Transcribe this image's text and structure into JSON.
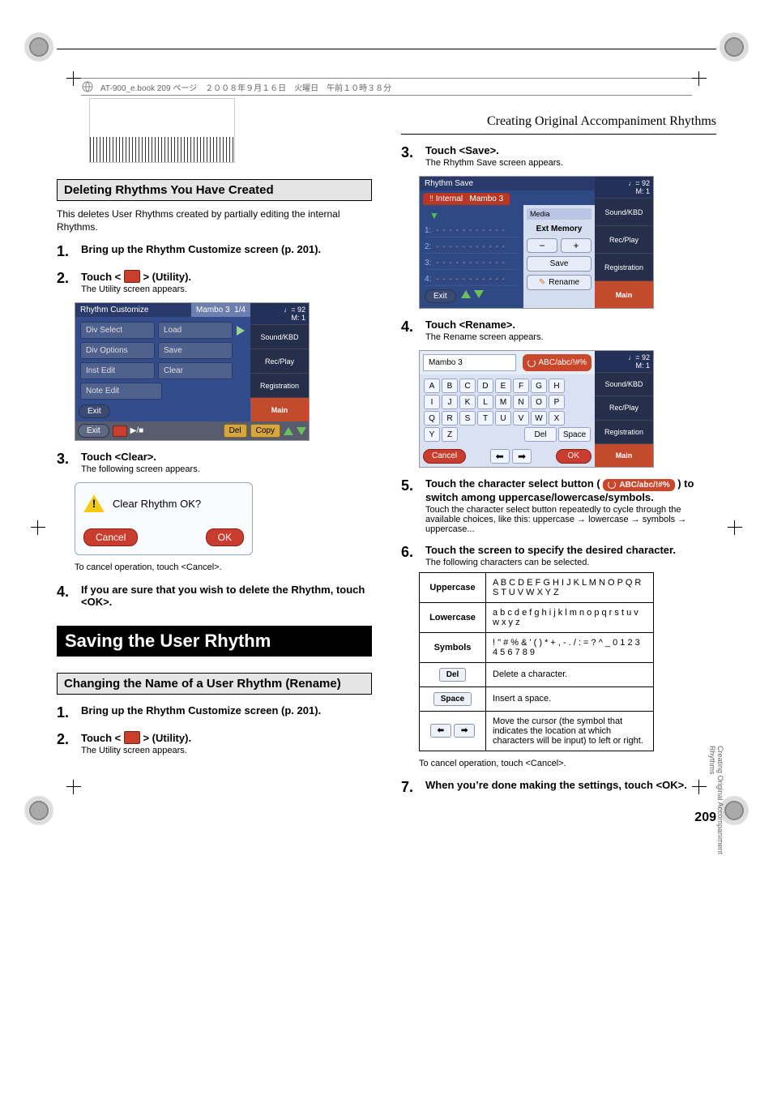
{
  "topbar": "AT-900_e.book  209 ページ　２００８年９月１６日　火曜日　午前１０時３８分",
  "chapter_title": "Creating Original Accompaniment Rhythms",
  "side_text": "Creating Original Accompaniment Rhythms",
  "page_number": "209",
  "left": {
    "h2_delete": "Deleting Rhythms You Have Created",
    "delete_intro": "This deletes User Rhythms created by partially editing the internal Rhythms.",
    "steps": {
      "s1": {
        "n": "1.",
        "title": "Bring up the Rhythm Customize screen (p. 201)."
      },
      "s2": {
        "n": "2.",
        "title_a": "Touch < ",
        "title_b": " > (Utility).",
        "sub": "The Utility screen appears."
      },
      "s3": {
        "n": "3.",
        "title": "Touch <Clear>.",
        "sub": "The following screen appears."
      },
      "s4": {
        "n": "4.",
        "title": "If you are sure that you wish to delete the Rhythm, touch <OK>."
      }
    },
    "clear_note": "To cancel operation, touch <Cancel>.",
    "h1_save": "Saving the User Rhythm",
    "h2_rename": "Changing the Name of a User Rhythm (Rename)",
    "r1": {
      "n": "1.",
      "title": "Bring up the Rhythm Customize screen (p. 201)."
    },
    "r2": {
      "n": "2.",
      "title_a": "Touch < ",
      "title_b": " > (Utility).",
      "sub": "The Utility screen appears."
    },
    "util": {
      "hdr_title": "Rhythm Customize",
      "hdr_sub": "Mambo 3",
      "hdr_page": "1/4",
      "tempo": "♩= 92",
      "meas": "M:    1",
      "side": {
        "sound": "Sound/KBD",
        "rec": "Rec/Play",
        "reg": "Registration",
        "main": "Main"
      },
      "btns": {
        "div_select": "Div Select",
        "load": "Load",
        "div_options": "Div Options",
        "save": "Save",
        "inst_edit": "Inst Edit",
        "clear": "Clear",
        "note_edit": "Note Edit",
        "exit_small": "Exit"
      },
      "footer": {
        "exit": "Exit",
        "del": "Del",
        "copy": "Copy"
      }
    },
    "dlg": {
      "msg": "Clear Rhythm OK?",
      "cancel": "Cancel",
      "ok": "OK"
    }
  },
  "right": {
    "s3": {
      "n": "3.",
      "title": "Touch <Save>.",
      "sub": "The Rhythm Save screen appears."
    },
    "s4": {
      "n": "4.",
      "title": "Touch <Rename>.",
      "sub": "The Rename screen appears."
    },
    "s5": {
      "n": "5.",
      "title_a": "Touch the character select button ( ",
      "title_b": " ) to switch among uppercase/lowercase/symbols.",
      "sub": "Touch the character select button repeatedly to cycle through the available choices, like this: uppercase → lowercase → symbols → uppercase..."
    },
    "s6": {
      "n": "6.",
      "title": "Touch the screen to specify the desired character.",
      "sub": "The following characters can be selected."
    },
    "s7_note": "To cancel operation, touch <Cancel>.",
    "s7": {
      "n": "7.",
      "title": "When you’re done making the settings, touch <OK>."
    },
    "save": {
      "hdr_title": "Rhythm Save",
      "tab_internal": "Internal",
      "tab_name": "Mambo 3",
      "media_label": "Media",
      "ext_mem": "Ext Memory",
      "rows": [
        "1:",
        "2:",
        "3:",
        "4:"
      ],
      "dashes": "- - - - - - - - - - -",
      "save": "Save",
      "rename": "Rename",
      "exit": "Exit",
      "tempo": "♩= 92",
      "meas": "M:    1",
      "side": {
        "sound": "Sound/KBD",
        "rec": "Rec/Play",
        "reg": "Registration",
        "main": "Main"
      }
    },
    "rename": {
      "name_value": "Mambo 3",
      "caseswitch": "ABC/abc/!#%",
      "rows": [
        [
          "A",
          "B",
          "C",
          "D",
          "E",
          "F",
          "G",
          "H"
        ],
        [
          "I",
          "J",
          "K",
          "L",
          "M",
          "N",
          "O",
          "P"
        ],
        [
          "Q",
          "R",
          "S",
          "T",
          "U",
          "V",
          "W",
          "X"
        ]
      ],
      "last_row": [
        "Y",
        "Z"
      ],
      "del": "Del",
      "space": "Space",
      "cancel": "Cancel",
      "ok": "OK",
      "tempo": "♩= 92",
      "meas": "M:    1",
      "side": {
        "sound": "Sound/KBD",
        "rec": "Rec/Play",
        "reg": "Registration",
        "main": "Main"
      }
    },
    "chartable": {
      "upper_h": "Uppercase",
      "upper_v": "A B C D E F G H I J K L M N O P Q R S T U V W X Y Z",
      "lower_h": "Lowercase",
      "lower_v": "a b c d e f g h i j k l m n o p q r s t u v w x y z",
      "sym_h": "Symbols",
      "sym_v": "! \" # % & ' ( ) * + , - . / : = ? ^ _ 0 1 2 3 4 5 6 7 8 9",
      "del_v": "Delete a character.",
      "space_v": "Insert a space.",
      "arrows_v": "Move the cursor (the symbol that indicates the location at which characters will be input) to left or right."
    }
  }
}
